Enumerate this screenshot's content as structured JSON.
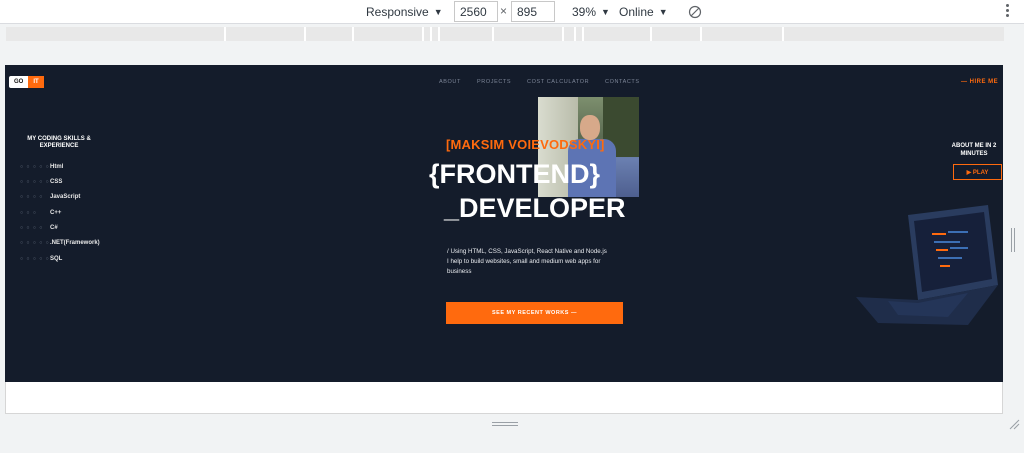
{
  "devtools": {
    "device": "Responsive",
    "width": "2560",
    "times": "×",
    "height": "895",
    "zoom": "39%",
    "network": "Online"
  },
  "site": {
    "logo": {
      "left": "GO",
      "right": "IT"
    },
    "nav": [
      "ABOUT",
      "PROJECTS",
      "COST CALCULATOR",
      "CONTACTS"
    ],
    "hire": "— HIRE ME",
    "skills_title": "MY CODING SKILLS & EXPERIENCE",
    "skills": [
      {
        "dots": "○ ○ ○ ○ ○",
        "label": "Html"
      },
      {
        "dots": "○ ○ ○ ○ ○",
        "label": "CSS"
      },
      {
        "dots": "○ ○ ○ ○",
        "label": "JavaScript"
      },
      {
        "dots": "○ ○ ○",
        "label": "C++"
      },
      {
        "dots": "○ ○ ○ ○",
        "label": "C#"
      },
      {
        "dots": "○ ○ ○ ○ ○",
        "label": ".NET(Framework)"
      },
      {
        "dots": "○ ○ ○ ○ ○",
        "label": "SQL"
      }
    ],
    "name": "[MAKSIM VOIEVODSKYI]",
    "hero_line1": "{FRONTEND}",
    "hero_line2": "_DEVELOPER",
    "description": "/ Using HTML, CSS, JavaScript, React Native and Node.js I help to build websites, small and medium web apps for business",
    "cta": "SEE MY RECENT WORKS —",
    "about": "ABOUT ME IN 2 MINUTES",
    "play": "▶ PLAY"
  },
  "colors": {
    "accent": "#ff6a0e",
    "background": "#141c2b"
  }
}
